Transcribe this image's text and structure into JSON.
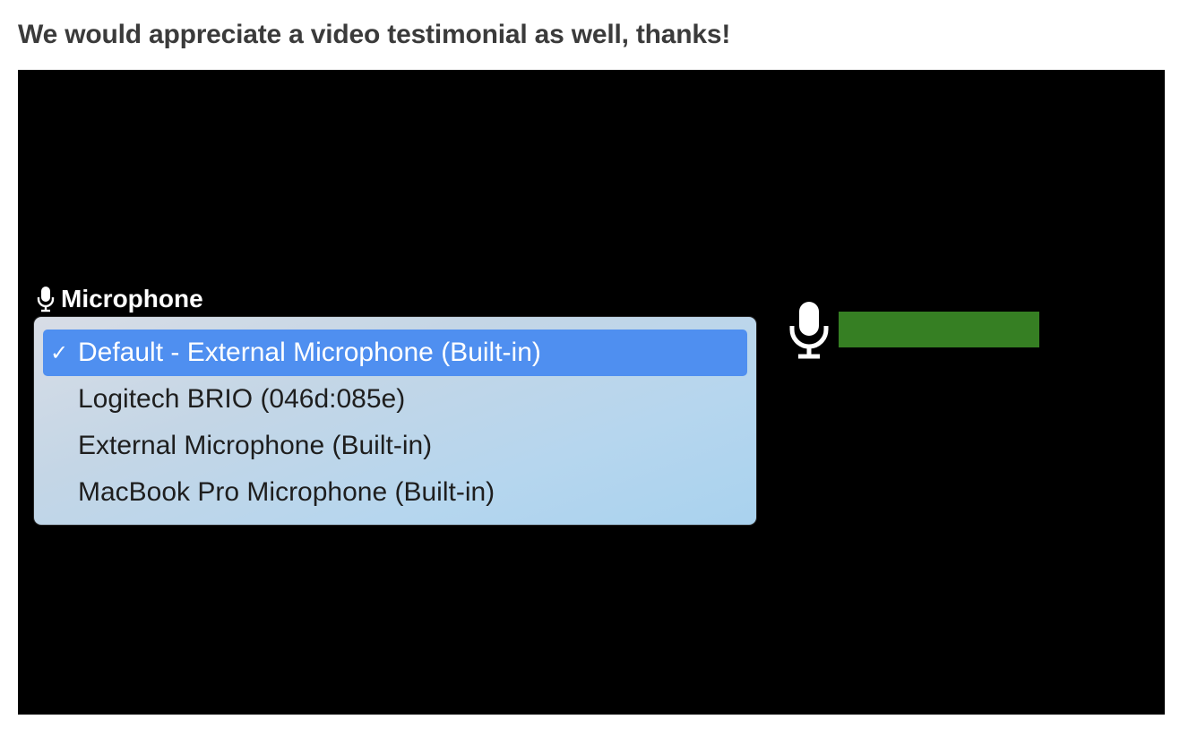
{
  "prompt": {
    "text": "We would appreciate a video testimonial as well, thanks!"
  },
  "microphone": {
    "label": "Microphone",
    "icon": "microphone-icon",
    "options": [
      {
        "label": "Default - External Microphone (Built-in)",
        "selected": true
      },
      {
        "label": "Logitech BRIO (046d:085e)",
        "selected": false
      },
      {
        "label": "External Microphone (Built-in)",
        "selected": false
      },
      {
        "label": "MacBook Pro Microphone (Built-in)",
        "selected": false
      }
    ],
    "check_glyph": "✓"
  },
  "audio_level": {
    "icon": "microphone-icon",
    "color": "#367f23"
  },
  "colors": {
    "panel_background": "#000000",
    "selected_background": "#4f8ff0",
    "level_bar": "#367f23"
  }
}
